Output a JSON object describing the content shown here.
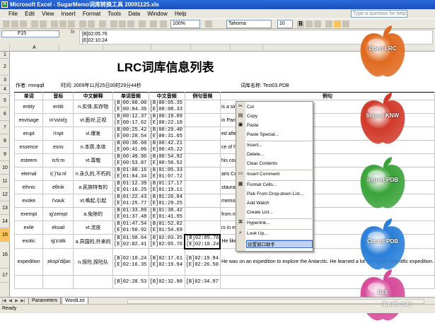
{
  "window": {
    "title": "Microsoft Excel - SugarMemo词库转换工具 20091125.xls"
  },
  "menu": {
    "items": [
      "File",
      "Edit",
      "View",
      "Insert",
      "Format",
      "Tools",
      "Data",
      "Window",
      "Help"
    ],
    "help_placeholder": "Type a question for help"
  },
  "toolbar": {
    "zoom": "100%",
    "font": "Tahoma",
    "size": "10"
  },
  "formula": {
    "name_box": "F15",
    "fx": "fx",
    "content_line1": "[B]02:05.76",
    "content_line2": "[E]02:10.24"
  },
  "columns": {
    "A": "A"
  },
  "rows": [
    "1",
    "2",
    "3",
    "4",
    "5",
    "6",
    "7",
    "8",
    "9",
    "10",
    "11",
    "12",
    "13",
    "14",
    "15",
    "16",
    "17"
  ],
  "selected_row": "15",
  "sheet": {
    "title": "LRC词库信息列表",
    "author": "作者: mmqqll",
    "time": "时间: 2009年11月25日00时29分44秒",
    "dict_name": "词库名称: Test03.PDB",
    "headers": [
      "单词",
      "音标",
      "中文解释",
      "单词音频",
      "中文音频",
      "例句音频",
      "例句"
    ],
    "data": [
      [
        "entity",
        "entiti",
        "n.实体,实存物",
        "[B]00:00.00\n[E]00:04.36",
        "[B]00:05.35\n[E]00:08.33",
        "",
        "is a single entity."
      ],
      [
        "envisage",
        "in'vizidʒ",
        "vt.面对,正视",
        "[B]00:12.37\n[E]00:17.62",
        "[B]00:19.09\n[E]00:22.18",
        "",
        "in Paris."
      ],
      [
        "erupt",
        "i'rʌpt",
        "vi.爆发",
        "[B]00:25.42\n[E]00:28.54",
        "[B]00:29.40\n[E]00:31.65",
        "",
        "ed after years of"
      ],
      [
        "essence",
        "esns",
        "n.本质,本体",
        "[B]00:36.60\n[E]00:41.06",
        "[B]00:42.21\n[E]00:45.22",
        "",
        "ce of happiness."
      ],
      [
        "esteem",
        "is'ti:m",
        "vt.尊敬",
        "[B]00:49.96\n[E]00:53.87",
        "[B]00:54.92\n[E]00:56.52",
        "",
        "his courage."
      ],
      [
        "eternal",
        "i(:)'tə:nl",
        "n.永久的,不朽的",
        "[B]01:00.16\n[E]01:04.34",
        "[B]01:05.33\n[E]01:07.72",
        "",
        "aris Commune are"
      ],
      [
        "ethnic",
        "eθnik",
        "a.民族特有的",
        "[B]01:12.39\n[E]01:16.25",
        "[B]01:17.17\n[E]01:19.11",
        "",
        "staurant."
      ],
      [
        "evoke",
        "i'vəuk",
        "vt.唤起,引起",
        "[B]01:22.43\n[E]01:25.77",
        "[B]01:26.84\n[E]01:29.25",
        "",
        "memories of his boyhood."
      ],
      [
        "exempt",
        "ig'zempt",
        "a.免除的",
        "[B]01:33.89\n[E]01:37.48",
        "[B]01:38.42\n[E]01:41.95",
        "",
        "from military service for"
      ],
      [
        "exile",
        "eksail",
        "vt.流放",
        "[B]01:47.54\n[E]01:50.92",
        "[B]01:52.02\n[E]01:54.69",
        "",
        "rs in exile."
      ],
      [
        "exotic",
        "ig'zɔtik",
        "a.异国的,外来的",
        "[B]01:58.64\n[E]02:02.41",
        "[B]02:03.35\n[E]02:05.76",
        "[B]02:05.76\n[E]02:10.24",
        "He liked New York for its exotic manners."
      ],
      [
        "expedition",
        "ˌekspi'diʃən",
        "n.探险,探险队",
        "[B]02:10.24\n[E]02:16.35",
        "[B]02:17.61\n[E]02:19.94",
        "[B]02:19.94\n[E]02:26.50",
        "He was on an expedition to explore the Antarctic. He learned a lot during his scientific expedition."
      ],
      [
        "",
        "",
        "",
        "[B]02:28.53",
        "[B]02:32.90",
        "[B]02:34.97",
        ""
      ]
    ]
  },
  "context_menu": {
    "items": [
      "Cut",
      "Copy",
      "Paste",
      "Paste Special...",
      "Insert...",
      "Delete...",
      "Clear Contents",
      "Insert Comment",
      "Format Cells...",
      "Pick From Drop-down List...",
      "Add Watch",
      "Create List...",
      "Hyperlink...",
      "Look Up...",
      "设置窗口助手"
    ],
    "highlight": "设置窗口助手"
  },
  "sheet_tabs": [
    "Parameters",
    "WordList"
  ],
  "active_tab": "WordList",
  "status": {
    "text": "Ready"
  },
  "side_panel": {
    "buttons": [
      "Open LRC",
      "Import KNW",
      "Import PDB",
      "Create PDB",
      "Exit"
    ],
    "colors": [
      "#e06a20",
      "#d03a2a",
      "#3aa33a",
      "#2a7fd8",
      "#d64a9a"
    ]
  },
  "watermark": "itao8.com"
}
